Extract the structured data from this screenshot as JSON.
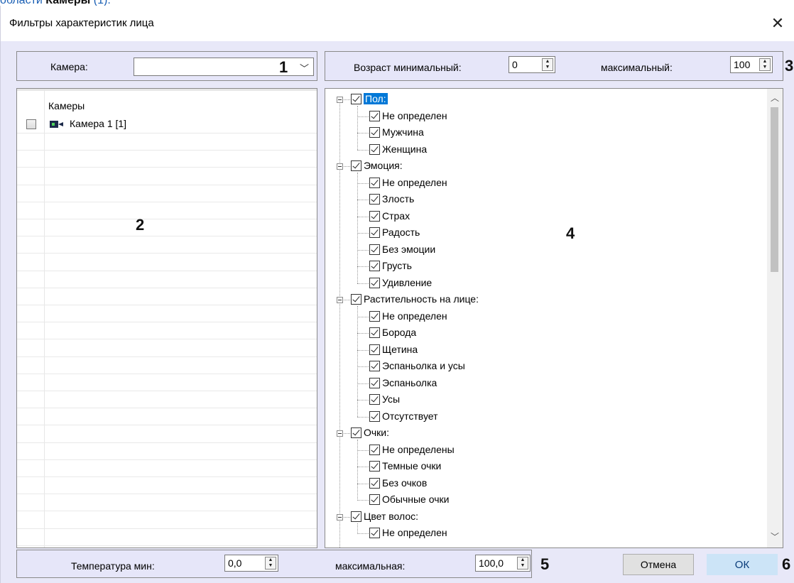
{
  "header_snippet": {
    "prefix": "области ",
    "bold": "Камеры",
    "suffix": " (1)."
  },
  "dialog": {
    "title": "Фильтры характеристик лица",
    "close_glyph": "✕"
  },
  "camera_group": {
    "label": "Камера:",
    "selected": "",
    "callout": "1"
  },
  "age_group": {
    "min_label": "Возраст минимальный:",
    "min_value": "0",
    "max_label": "максимальный:",
    "max_value": "100",
    "callout": "3"
  },
  "camera_list": {
    "header": "Камеры",
    "items": [
      {
        "label": "Камера 1 [1]",
        "checked": false
      }
    ],
    "callout": "2"
  },
  "tree": {
    "callout": "4",
    "groups": [
      {
        "label": "Пол:",
        "selected": true,
        "items": [
          "Не определен",
          "Мужчина",
          "Женщина"
        ]
      },
      {
        "label": "Эмоция:",
        "items": [
          "Не определен",
          "Злость",
          "Страх",
          "Радость",
          "Без эмоции",
          "Грусть",
          "Удивление"
        ]
      },
      {
        "label": "Растительность на лице:",
        "items": [
          "Не определен",
          "Борода",
          "Щетина",
          "Эспаньолка и усы",
          "Эспаньолка",
          "Усы",
          "Отсутствует"
        ]
      },
      {
        "label": "Очки:",
        "items": [
          "Не определены",
          "Темные очки",
          "Без очков",
          "Обычные очки"
        ]
      },
      {
        "label": "Цвет волос:",
        "items": [
          "Не определен"
        ]
      }
    ]
  },
  "temperature_group": {
    "min_label": "Температура мин:",
    "min_value": "0,0",
    "max_label": "максимальная:",
    "max_value": "100,0",
    "callout": "5"
  },
  "buttons": {
    "cancel": "Отмена",
    "ok": "ОК",
    "callout": "6"
  },
  "icons": {
    "camera": "camera-icon",
    "close": "close-icon",
    "expander": "collapse-icon"
  }
}
